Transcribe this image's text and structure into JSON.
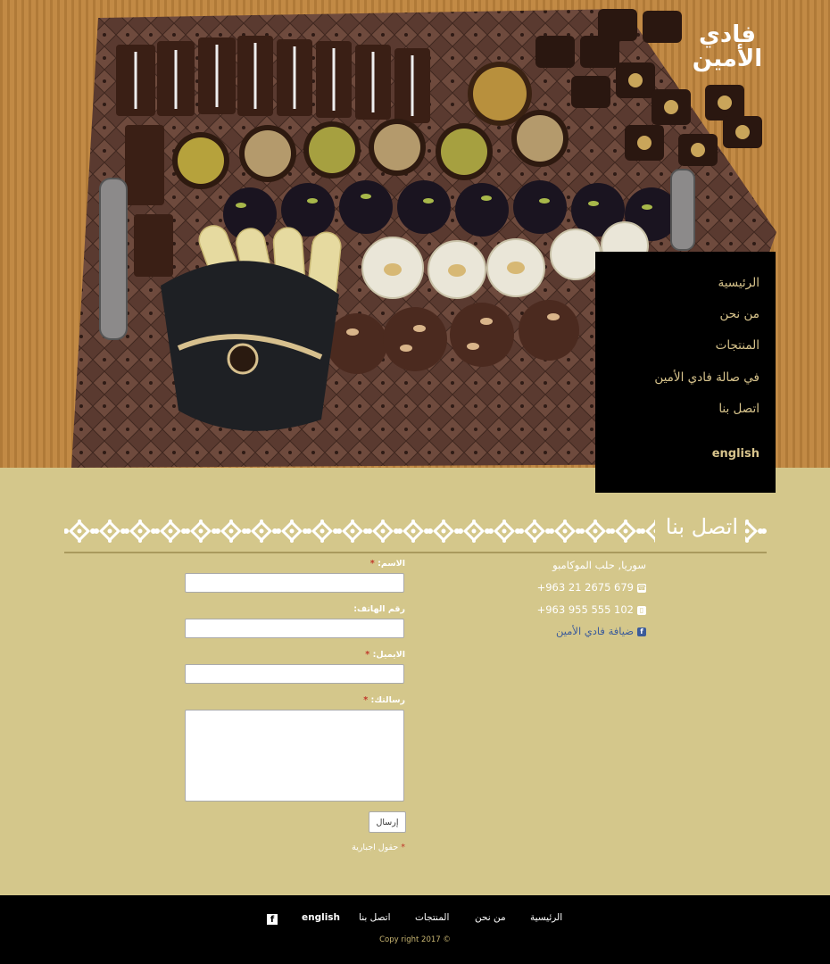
{
  "brand": {
    "logo_line1": "فادي",
    "logo_line2": "الأمين"
  },
  "nav": {
    "items": [
      "الرئيسية",
      "من نحن",
      "المنتجات",
      "في صالة فادي الأمين",
      "اتصل بنا"
    ],
    "english": "english"
  },
  "contact": {
    "title": "اتصل بنا",
    "form": {
      "name_label": "الاسم:",
      "phone_label": "رقم الهاتف:",
      "email_label": "الايميل:",
      "message_label": "رسالتك:",
      "required_mark": "*",
      "name_value": "",
      "phone_value": "",
      "email_value": "",
      "message_value": "",
      "submit_label": "إرسال",
      "required_note": "حقول اجبارية"
    },
    "info": {
      "address": "سوريا, حلب الموكامبو",
      "phone": "+963 21 2675 679",
      "mobile": "+963 955 555 102",
      "facebook": "ضيافة فادي الأمين"
    }
  },
  "footer": {
    "links": [
      "الرئيسية",
      "من نحن",
      "المنتجات",
      "اتصل بنا"
    ],
    "english": "english",
    "copyright": "Copy right 2017 ©"
  },
  "colors": {
    "page_bg": "#d4c78b",
    "nav_bg": "#000000",
    "nav_text": "#d8c48c",
    "facebook": "#3b5b9a",
    "required": "#c0392b"
  }
}
